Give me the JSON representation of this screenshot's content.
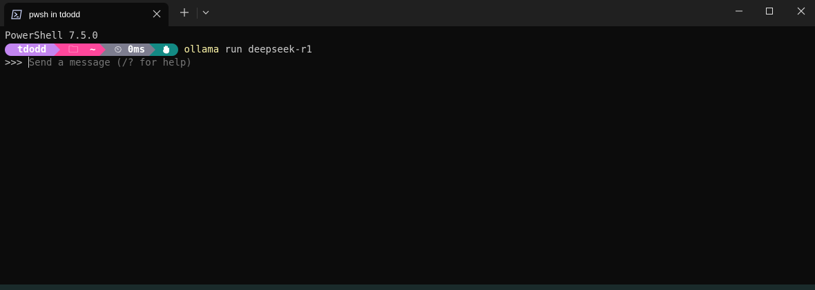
{
  "tab": {
    "title": "pwsh in tdodd",
    "icon": "powershell-icon"
  },
  "window_controls": {
    "minimize_icon": "minimize-icon",
    "maximize_icon": "maximize-icon",
    "close_icon": "close-icon"
  },
  "terminal": {
    "banner": "PowerShell 7.5.0",
    "prompt": {
      "user": "tdodd",
      "path_icon": "folder-icon",
      "path": "~",
      "time_icon": "stopwatch-icon",
      "time": "0ms",
      "end_icon": "hand-icon"
    },
    "command_name": "ollama",
    "command_args": " run deepseek-r1",
    "input_prompt": ">>> ",
    "input_placeholder": "Send a message (/? for help)"
  },
  "colors": {
    "background": "#0c0c0c",
    "titlebar": "#202020",
    "user_segment": "#c386f1",
    "path_segment": "#ff479c",
    "time_segment": "#7d7d8f",
    "end_segment": "#138a84",
    "command": "#f9f1a5"
  }
}
